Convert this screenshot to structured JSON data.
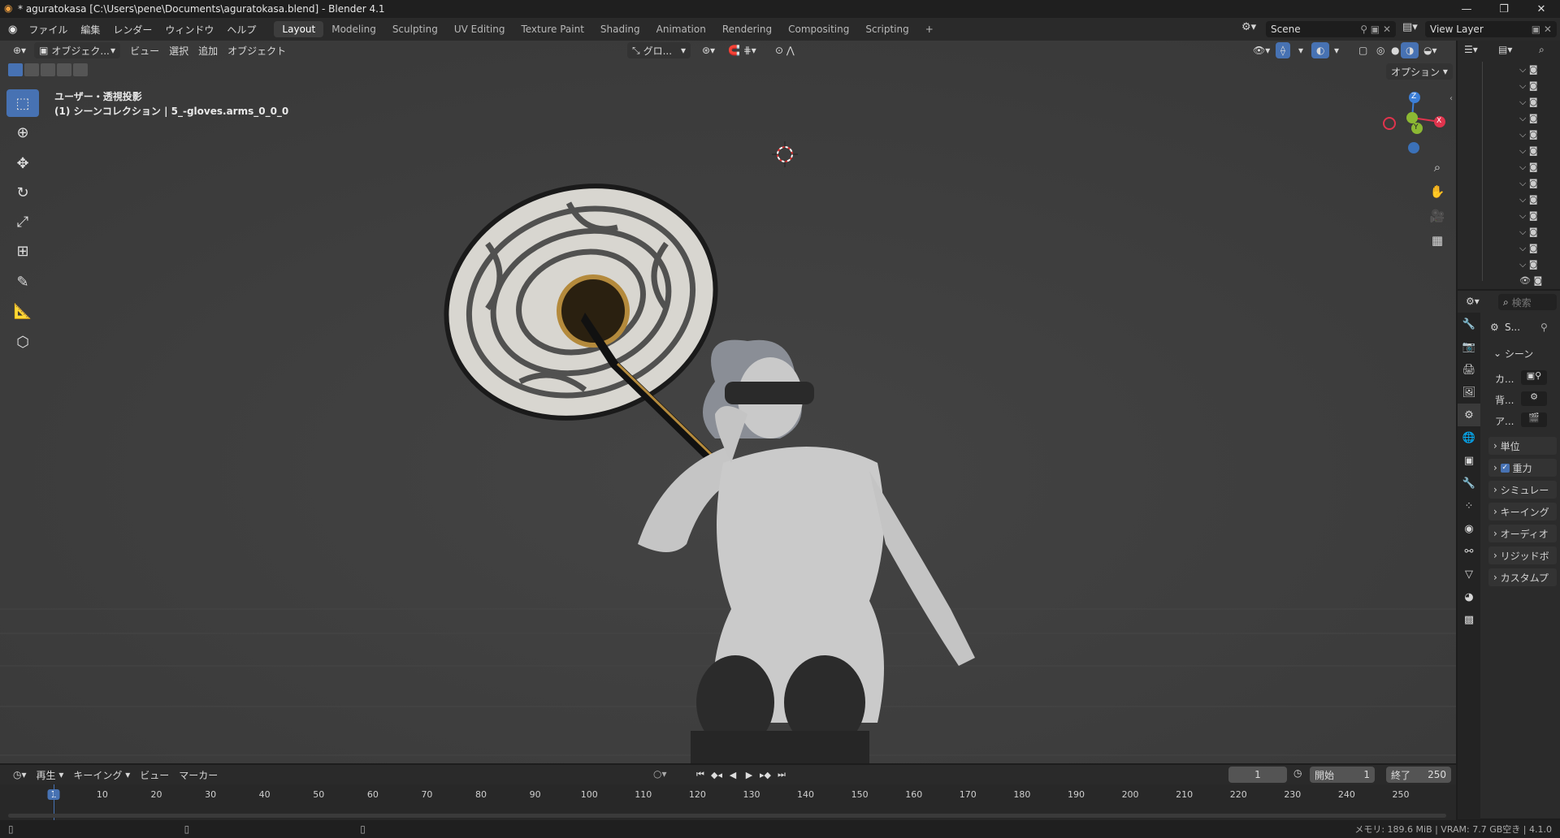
{
  "window": {
    "title": "* aguratokasa [C:\\Users\\pene\\Documents\\aguratokasa.blend] - Blender 4.1",
    "minimize": "—",
    "maximize": "❐",
    "close": "✕"
  },
  "menu": [
    "ファイル",
    "編集",
    "レンダー",
    "ウィンドウ",
    "ヘルプ"
  ],
  "workspaces": [
    "Layout",
    "Modeling",
    "Sculpting",
    "UV Editing",
    "Texture Paint",
    "Shading",
    "Animation",
    "Rendering",
    "Compositing",
    "Scripting"
  ],
  "add_workspace": "+",
  "scene": {
    "name": "Scene",
    "view_layer": "View Layer"
  },
  "viewport_header": {
    "mode": "オブジェク...",
    "menus": [
      "ビュー",
      "選択",
      "追加",
      "オブジェクト"
    ],
    "transform_orientation": "グロ...",
    "options": "オプション"
  },
  "viewport_overlay": {
    "line1": "ユーザー・透視投影",
    "line2": "(1) シーンコレクション | 5_-gloves.arms_0_0_0"
  },
  "gizmo": {
    "z": "Z",
    "y": "Y",
    "x": "X"
  },
  "properties": {
    "search_placeholder": "検索",
    "context_label": "S...",
    "scene_section": "シーン",
    "scene_fields": [
      "カ...",
      "背...",
      "ア..."
    ],
    "panels": [
      "単位",
      "重力",
      "シミュレー",
      "キーイング",
      "オーディオ",
      "リジッドボ",
      "カスタムプ"
    ]
  },
  "timeline": {
    "menus": [
      "再生",
      "キーイング",
      "ビュー",
      "マーカー"
    ],
    "current_frame": "1",
    "start_label": "開始",
    "start_value": "1",
    "end_label": "終了",
    "end_value": "250",
    "ticks": [
      "1",
      "10",
      "20",
      "30",
      "40",
      "50",
      "60",
      "70",
      "80",
      "90",
      "100",
      "110",
      "120",
      "130",
      "140",
      "150",
      "160",
      "170",
      "180",
      "190",
      "200",
      "210",
      "220",
      "230",
      "240",
      "250"
    ]
  },
  "status": {
    "memory": "メモリ: 189.6 MiB | VRAM: 7.7 GB空き | 4.1.0"
  },
  "colors": {
    "accent": "#4772b3",
    "viewport_bg": "#3d3d3d",
    "x_axis": "#e0344d",
    "y_axis": "#8cb833",
    "z_axis": "#3c7fd8"
  }
}
